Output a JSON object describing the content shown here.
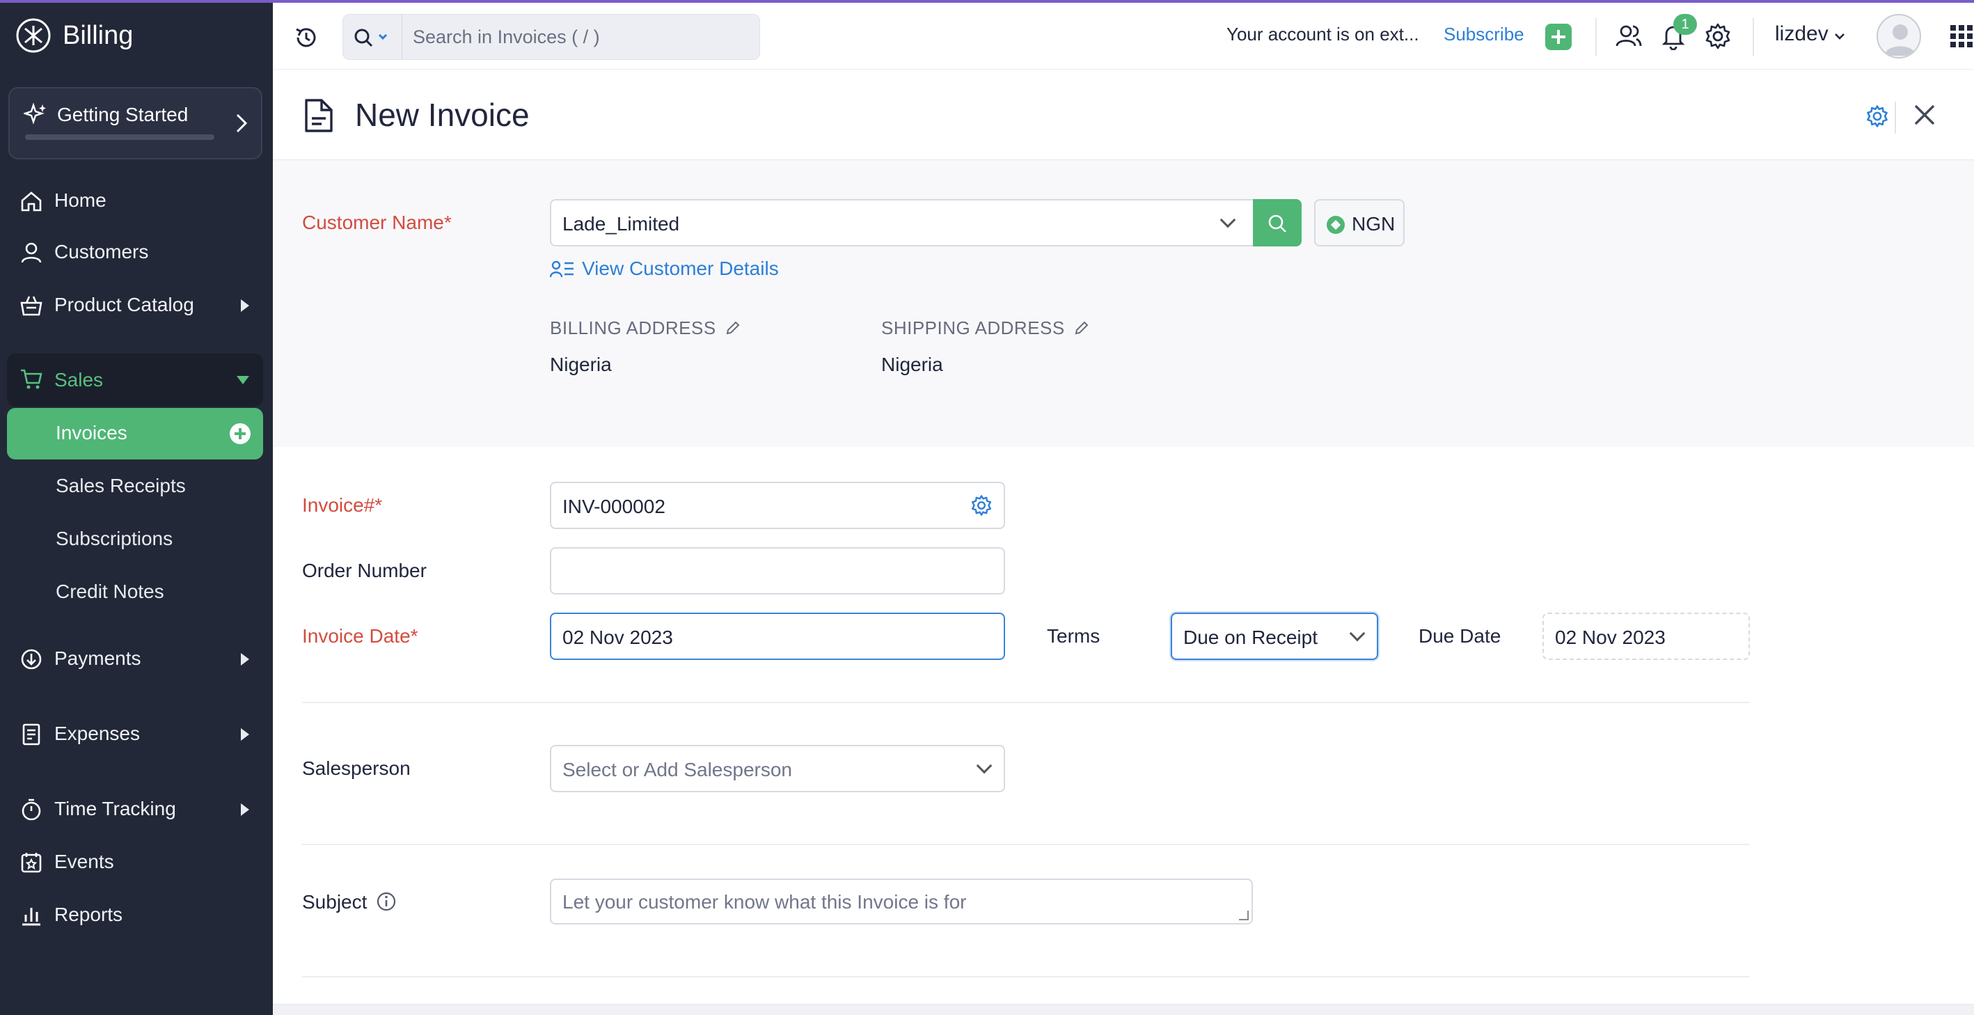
{
  "app": {
    "name": "Billing"
  },
  "sidebar": {
    "getting_started": "Getting Started",
    "items": {
      "home": "Home",
      "customers": "Customers",
      "product_catalog": "Product Catalog",
      "sales": "Sales",
      "payments": "Payments",
      "expenses": "Expenses",
      "time_tracking": "Time Tracking",
      "events": "Events",
      "reports": "Reports"
    },
    "sales_sub": {
      "invoices": "Invoices",
      "sales_receipts": "Sales Receipts",
      "subscriptions": "Subscriptions",
      "credit_notes": "Credit Notes"
    }
  },
  "header": {
    "search_placeholder": "Search in Invoices ( / )",
    "account_message": "Your account is on ext...",
    "subscribe": "Subscribe",
    "notification_count": "1",
    "user": "lizdev"
  },
  "page": {
    "title": "New Invoice"
  },
  "form": {
    "customer_name_label": "Customer Name*",
    "customer_name_value": "Lade_Limited",
    "currency": "NGN",
    "view_customer_details": "View Customer Details",
    "billing_address_label": "BILLING ADDRESS",
    "billing_address_value": "Nigeria",
    "shipping_address_label": "SHIPPING ADDRESS",
    "shipping_address_value": "Nigeria",
    "invoice_number_label": "Invoice#*",
    "invoice_number_value": "INV-000002",
    "order_number_label": "Order Number",
    "order_number_value": "",
    "invoice_date_label": "Invoice Date*",
    "invoice_date_value": "02 Nov 2023",
    "terms_label": "Terms",
    "terms_value": "Due on Receipt",
    "due_date_label": "Due Date",
    "due_date_value": "02 Nov 2023",
    "salesperson_label": "Salesperson",
    "salesperson_placeholder": "Select or Add Salesperson",
    "subject_label": "Subject",
    "subject_placeholder": "Let your customer know what this Invoice is for"
  },
  "colors": {
    "accent_green": "#4fb676",
    "sidebar_bg": "#232838",
    "link_blue": "#2c7fd6",
    "required_red": "#d24c3f"
  }
}
